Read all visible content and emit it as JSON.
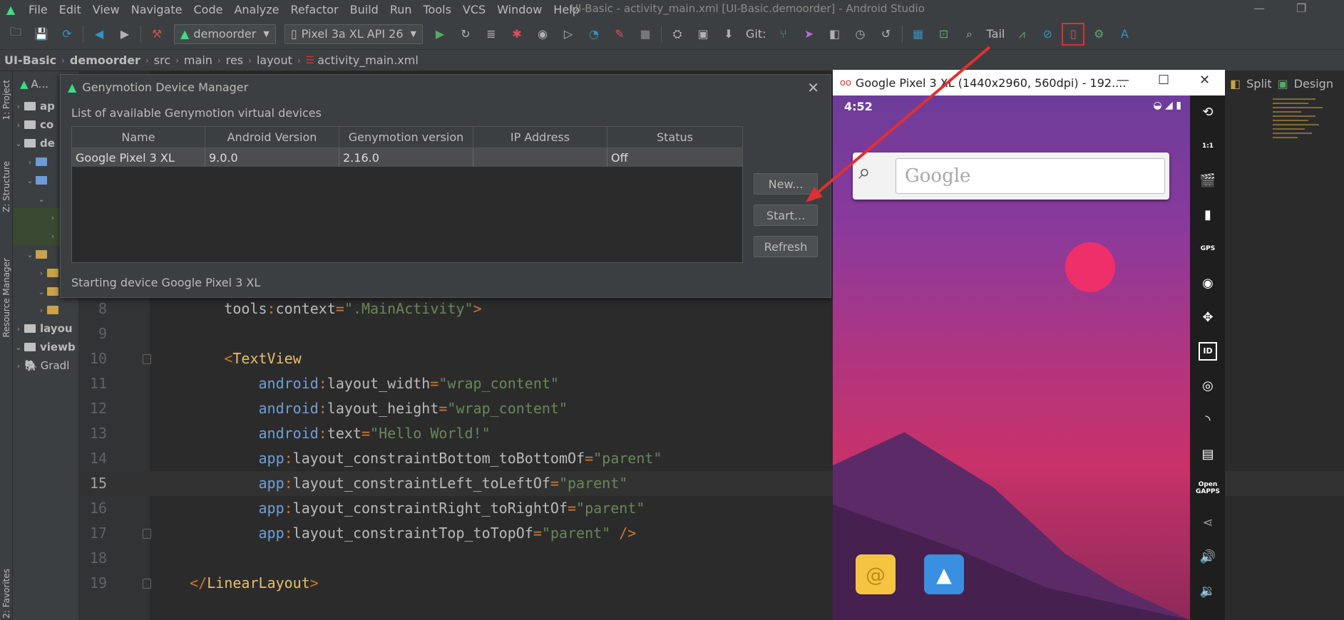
{
  "app": {
    "window_title": "UI-Basic - activity_main.xml [UI-Basic.demoorder] - Android Studio"
  },
  "menu": [
    "File",
    "Edit",
    "View",
    "Navigate",
    "Code",
    "Analyze",
    "Refactor",
    "Build",
    "Run",
    "Tools",
    "VCS",
    "Window",
    "Help"
  ],
  "toolbar": {
    "module_combo": "demoorder",
    "device_combo": "Pixel 3a XL API 26",
    "git_label": "Git:",
    "tail_label": "Tail",
    "highlight_color": "#e0302f"
  },
  "breadcrumb": [
    "UI-Basic",
    "demoorder",
    "src",
    "main",
    "res",
    "layout",
    "activity_main.xml"
  ],
  "left_tabs": {
    "project": "1: Project",
    "structure": "Z: Structure",
    "resource_manager": "Resource Manager",
    "favorites": "2: Favorites"
  },
  "project_panel": {
    "header": "A...",
    "items": [
      "ap",
      "co",
      "de",
      "",
      "",
      "",
      "",
      "",
      "",
      "",
      "",
      "",
      "layou",
      "viewb",
      "Gradl"
    ]
  },
  "editor": {
    "view_modes": [
      "Split",
      "Design"
    ],
    "lines": [
      {
        "n": "8",
        "segs": [
          [
            "c-name",
            "        tools"
          ],
          [
            "c-punc",
            ":"
          ],
          [
            "c-name",
            "context"
          ],
          [
            "c-punc",
            "="
          ],
          [
            "c-str",
            "\".MainActivity\""
          ],
          [
            "c-punc",
            ">"
          ]
        ]
      },
      {
        "n": "9",
        "segs": []
      },
      {
        "n": "10",
        "segs": [
          [
            "c-punc",
            "        <"
          ],
          [
            "c-tag",
            "TextView"
          ]
        ]
      },
      {
        "n": "11",
        "segs": [
          [
            "c-ns",
            "            android"
          ],
          [
            "c-punc",
            ":"
          ],
          [
            "c-name",
            "layout_width"
          ],
          [
            "c-punc",
            "="
          ],
          [
            "c-str",
            "\"wrap_content\""
          ]
        ]
      },
      {
        "n": "12",
        "segs": [
          [
            "c-ns",
            "            android"
          ],
          [
            "c-punc",
            ":"
          ],
          [
            "c-name",
            "layout_height"
          ],
          [
            "c-punc",
            "="
          ],
          [
            "c-str",
            "\"wrap_content\""
          ]
        ]
      },
      {
        "n": "13",
        "segs": [
          [
            "c-ns",
            "            android"
          ],
          [
            "c-punc",
            ":"
          ],
          [
            "c-name",
            "text"
          ],
          [
            "c-punc",
            "="
          ],
          [
            "c-str",
            "\"Hello World!\""
          ]
        ]
      },
      {
        "n": "14",
        "segs": [
          [
            "c-ns",
            "            app"
          ],
          [
            "c-punc",
            ":"
          ],
          [
            "c-name",
            "layout_constraintBottom_toBottomOf"
          ],
          [
            "c-punc",
            "="
          ],
          [
            "c-str",
            "\"parent\""
          ]
        ]
      },
      {
        "n": "15",
        "segs": [
          [
            "c-ns",
            "            app"
          ],
          [
            "c-punc",
            ":"
          ],
          [
            "c-name",
            "layout_constraintLeft_toLeftOf"
          ],
          [
            "c-punc",
            "="
          ],
          [
            "c-str",
            "\"parent\""
          ]
        ]
      },
      {
        "n": "16",
        "segs": [
          [
            "c-ns",
            "            app"
          ],
          [
            "c-punc",
            ":"
          ],
          [
            "c-name",
            "layout_constraintRight_toRightOf"
          ],
          [
            "c-punc",
            "="
          ],
          [
            "c-str",
            "\"parent\""
          ]
        ]
      },
      {
        "n": "17",
        "segs": [
          [
            "c-ns",
            "            app"
          ],
          [
            "c-punc",
            ":"
          ],
          [
            "c-name",
            "layout_constraintTop_toTopOf"
          ],
          [
            "c-punc",
            "="
          ],
          [
            "c-str",
            "\"parent\""
          ],
          [
            "c-punc",
            " />"
          ]
        ]
      },
      {
        "n": "18",
        "segs": []
      },
      {
        "n": "19",
        "segs": [
          [
            "c-punc",
            "    </"
          ],
          [
            "c-tag",
            "LinearLayout"
          ],
          [
            "c-punc",
            ">"
          ]
        ]
      }
    ],
    "current_line": "15"
  },
  "genymotion": {
    "title": "Genymotion Device Manager",
    "subtitle": "List of available Genymotion virtual devices",
    "columns": [
      "Name",
      "Android Version",
      "Genymotion version",
      "IP Address",
      "Status"
    ],
    "rows": [
      {
        "name": "Google Pixel 3 XL",
        "android": "9.0.0",
        "geny": "2.16.0",
        "ip": "",
        "status": "Off"
      }
    ],
    "buttons": {
      "new": "New...",
      "start": "Start...",
      "refresh": "Refresh"
    },
    "status_text": "Starting device Google Pixel 3 XL"
  },
  "emulator": {
    "title": "Google Pixel 3 XL (1440x2960, 560dpi) - 192....",
    "clock": "4:52",
    "search_placeholder": "Google",
    "side_buttons": [
      "rotate",
      "scale 1:1",
      "capture",
      "battery",
      "GPS",
      "camera",
      "move",
      "ID",
      "disk",
      "network",
      "sms",
      "Open GAPPS",
      "share",
      "volume-up",
      "volume-down"
    ],
    "side_labels": {
      "gps": "GPS",
      "id": "ID",
      "gapps": "Open\nGAPPS",
      "scale": "1:1"
    }
  }
}
